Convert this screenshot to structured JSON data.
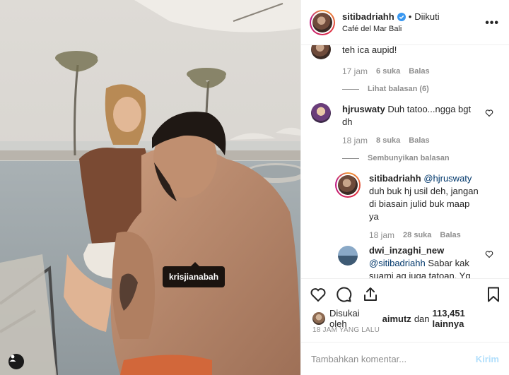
{
  "post": {
    "tag_username": "krisjianabah"
  },
  "header": {
    "username": "sitibadriahh",
    "separator": "•",
    "follow_state": "Diikuti",
    "location": "Café del Mar Bali",
    "more_label": "•••",
    "verified_icon": "verified-badge-icon"
  },
  "comments": [
    {
      "id": "c0",
      "username": "",
      "text": "teh ica aupid!",
      "time": "17 jam",
      "likes": "6 suka",
      "reply": "Balas",
      "toggle": "Lihat balasan (6)"
    },
    {
      "id": "c1",
      "username": "hjruswaty",
      "text": "Duh tatoo...ngga bgt dh",
      "time": "18 jam",
      "likes": "8 suka",
      "reply": "Balas",
      "toggle": "Sembunyikan balasan"
    },
    {
      "id": "r1",
      "username": "sitibadriahh",
      "mention": "@hjruswaty",
      "text": "duh buk hj usil deh, jangan di biasain julid buk maap ya",
      "time": "18 jam",
      "likes": "28 suka",
      "reply": "Balas"
    },
    {
      "id": "r2",
      "username": "dwi_inzaghi_new",
      "mention": "@sitibadriahh",
      "text": "Sabar kak suami ag juga tatoan. Yg"
    }
  ],
  "actions": {
    "like_icon": "heart-icon",
    "comment_icon": "comment-icon",
    "share_icon": "share-icon",
    "save_icon": "bookmark-icon"
  },
  "likes": {
    "prefix": "Disukai oleh",
    "first_user": "aimutz",
    "connector": "dan",
    "count": "113,451 lainnya"
  },
  "timestamp": "18 JAM YANG LALU",
  "add_comment": {
    "placeholder": "Tambahkan komentar...",
    "post_label": "Kirim"
  },
  "colors": {
    "link": "#00376b",
    "muted": "#8e8e8e",
    "post_disabled": "#b2dffc",
    "verified": "#3897f0"
  }
}
